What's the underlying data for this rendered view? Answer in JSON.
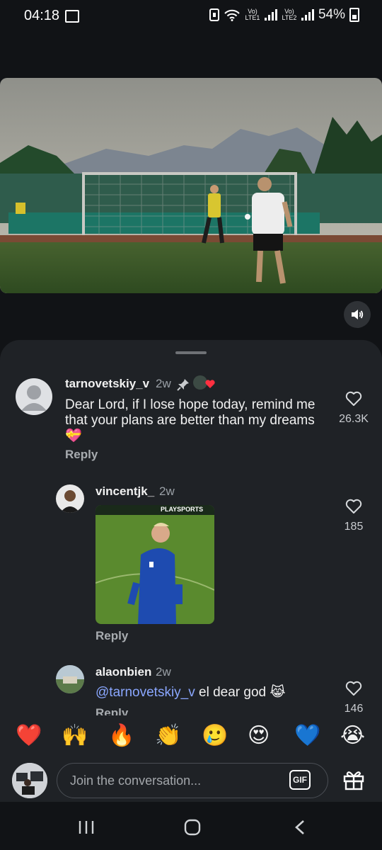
{
  "status_bar": {
    "time": "04:18",
    "signal1_label": "Vo) LTE1",
    "signal2_label": "Vo) LTE2",
    "battery": "54%"
  },
  "video": {
    "sound_icon": "volume-icon"
  },
  "comments": [
    {
      "username": "tarnovetskiy_v",
      "age": "2w",
      "text": "Dear Lord, if I lose hope today, remind me that your plans are better than my dreams 💝",
      "reply": "Reply",
      "likes": "26.3K",
      "pinned": true
    },
    {
      "username": "vincentjk_",
      "age": "2w",
      "gif_brand": "PLAYSPORTS",
      "reply": "Reply",
      "likes": "185"
    },
    {
      "username": "alaonbien",
      "age": "2w",
      "mention": "@tarnovetskiy_v",
      "text": " el dear god 😹",
      "reply": "Reply",
      "likes": "146"
    }
  ],
  "reactions": [
    "❤️",
    "🙌",
    "🔥",
    "👏",
    "🥲",
    "😍",
    "💙",
    "😭"
  ],
  "composer": {
    "placeholder": "Join the conversation...",
    "gif_label": "GIF"
  },
  "colors": {
    "background": "#111316",
    "sheet": "#1f2226",
    "mention": "#8aa7ff"
  }
}
